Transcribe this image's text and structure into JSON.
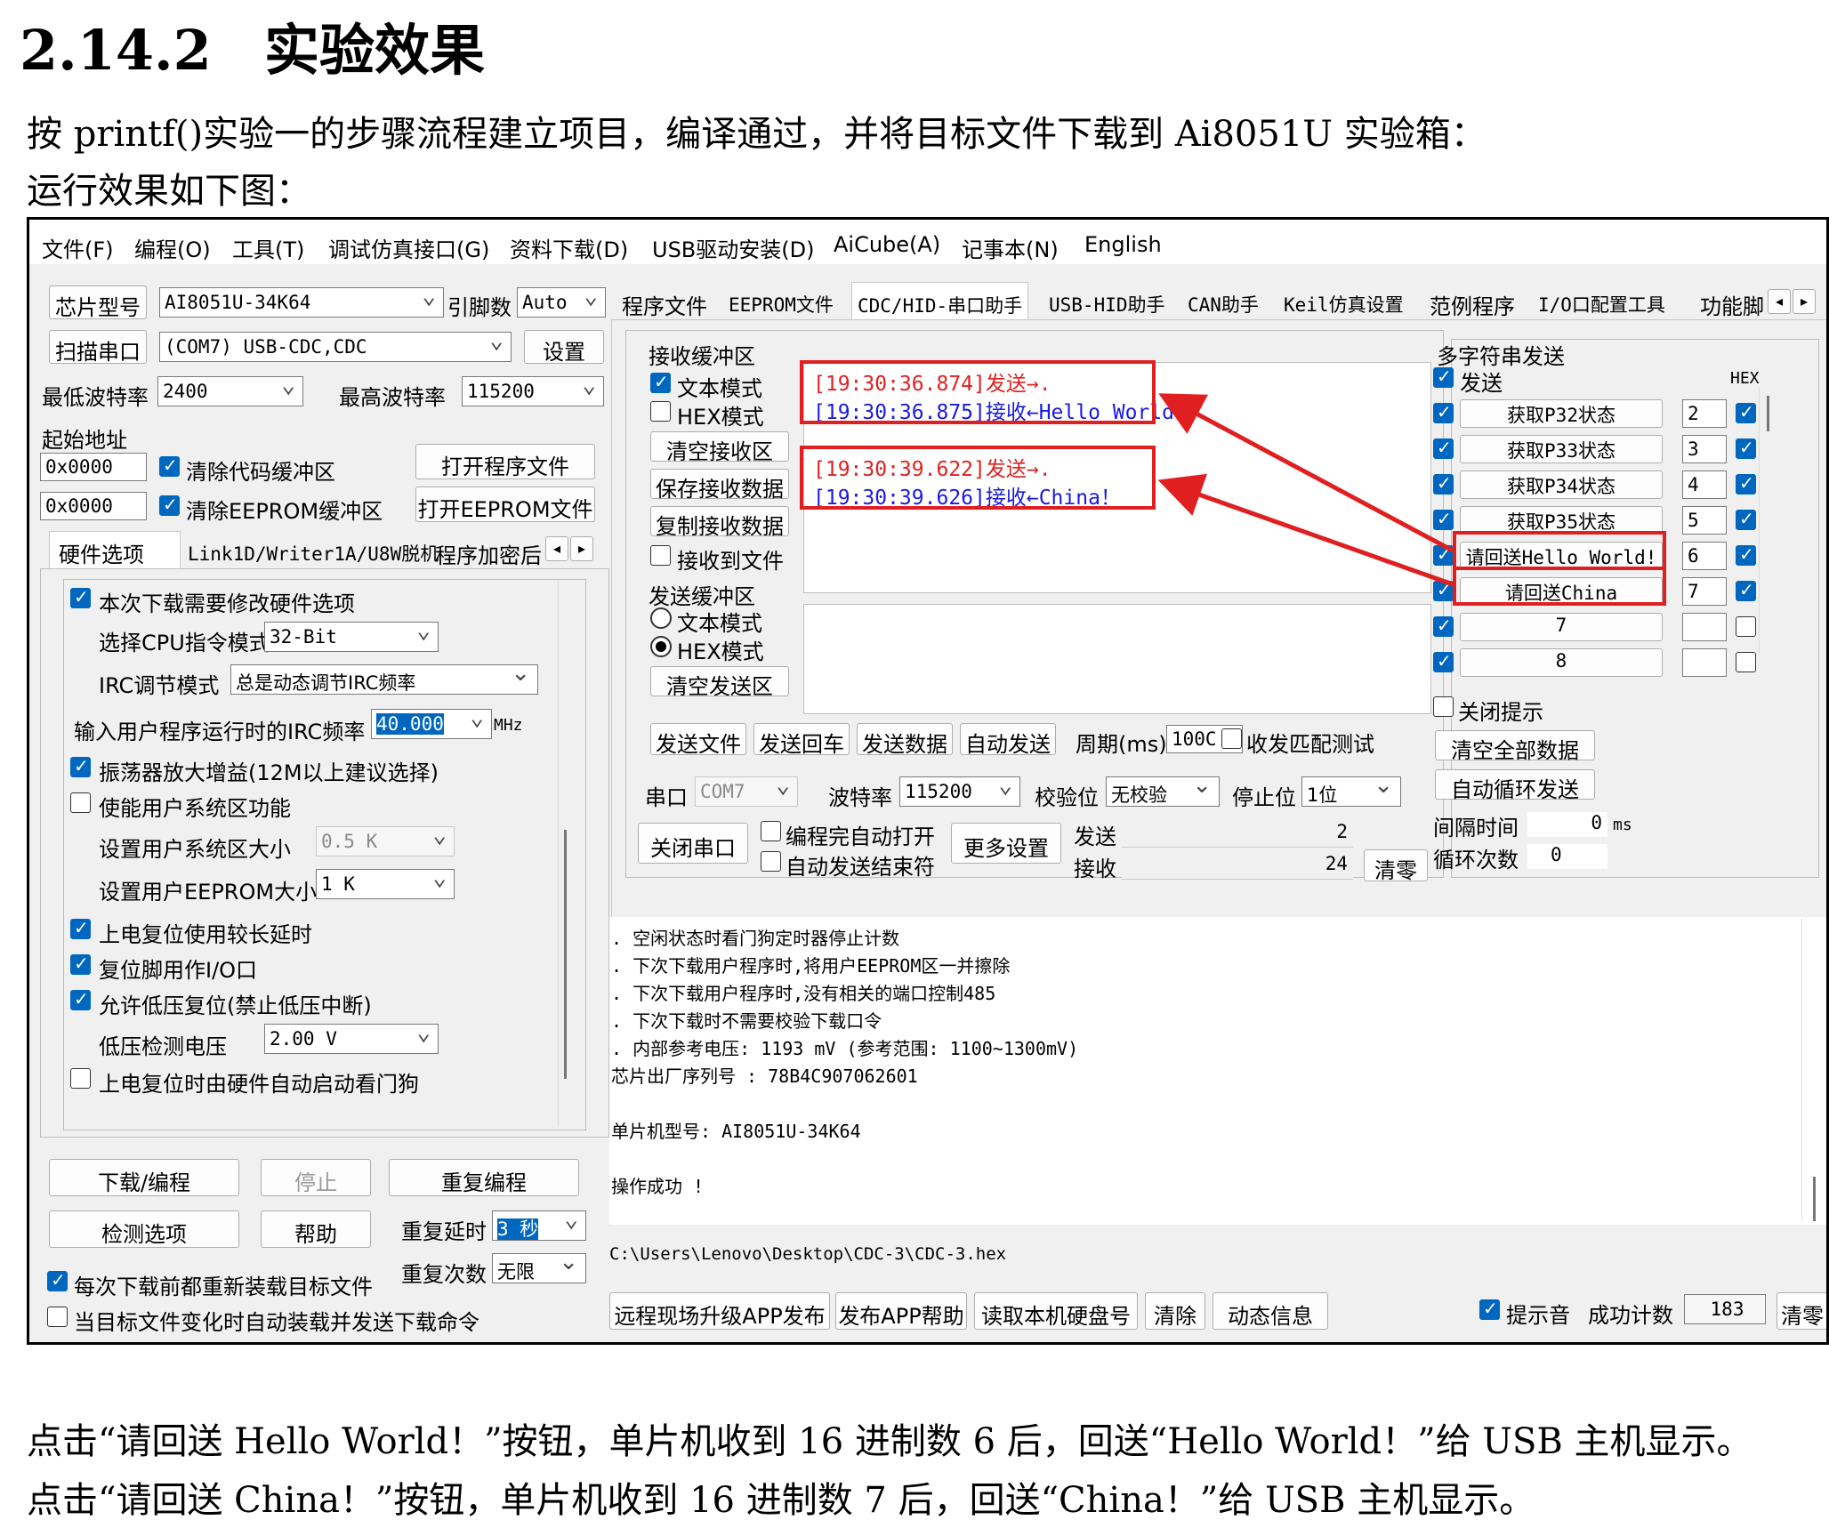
{
  "doc": {
    "section_number": "2.14.2",
    "section_title": "实验效果",
    "intro_line1": "按 printf()实验一的步骤流程建立项目，编译通过，并将目标文件下载到 Ai8051U 实验箱：",
    "intro_line2": "运行效果如下图：",
    "outro_line1": "点击“请回送 Hello World！”按钮，单片机收到 16 进制数 6 后，回送“Hello World！”给 USB 主机显示。",
    "outro_line2": "点击“请回送 China！”按钮，单片机收到 16 进制数 7 后，回送“China！”给 USB 主机显示。"
  },
  "menu": [
    "文件(F)",
    "编程(O)",
    "工具(T)",
    "调试仿真接口(G)",
    "资料下载(D)",
    "USB驱动安装(D)",
    "AiCube(A)",
    "记事本(N)",
    "English"
  ],
  "left": {
    "chip_label": "芯片型号",
    "chip_value": "AI8051U-34K64",
    "pins_label": "引脚数",
    "pins_value": "Auto",
    "scan_label": "扫描串口",
    "port_value": "(COM7) USB-CDC,CDC",
    "settings_label": "设置",
    "min_baud_label": "最低波特率",
    "min_baud_value": "2400",
    "max_baud_label": "最高波特率",
    "max_baud_value": "115200",
    "start_addr_label": "起始地址",
    "addr1": "0x0000",
    "clear_code_label": "清除代码缓冲区",
    "open_prog_label": "打开程序文件",
    "addr2": "0x0000",
    "clear_eeprom_label": "清除EEPROM缓冲区",
    "open_eeprom_label": "打开EEPROM文件",
    "subtabs": [
      "硬件选项",
      "Link1D/Writer1A/U8W脱机",
      "程序加密后"
    ],
    "opt_modify": "本次下载需要修改硬件选项",
    "cpu_mode_label": "选择CPU指令模式",
    "cpu_mode_value": "32-Bit",
    "irc_mode_label": "IRC调节模式",
    "irc_mode_value": "总是动态调节IRC频率",
    "irc_freq_label": "输入用户程序运行时的IRC频率",
    "irc_freq_value": "40.000",
    "irc_freq_unit": "MHz",
    "opt_osc": "振荡器放大增益(12M以上建议选择)",
    "opt_sysarea": "使能用户系统区功能",
    "sysarea_size_label": "设置用户系统区大小",
    "sysarea_size_value": "0.5 K",
    "eeprom_size_label": "设置用户EEPROM大小",
    "eeprom_size_value": "1   K",
    "opt_delay": "上电复位使用较长延时",
    "opt_resetio": "复位脚用作I/O口",
    "opt_lvr": "允许低压复位(禁止低压中断)",
    "lvd_label": "低压检测电压",
    "lvd_value": "2.00 V",
    "opt_wdt": "上电复位时由硬件自动启动看门狗",
    "btn_download": "下载/编程",
    "btn_stop": "停止",
    "btn_repeat": "重复编程",
    "btn_check": "检测选项",
    "btn_help": "帮助",
    "repeat_delay_label": "重复延时",
    "repeat_delay_value": "3 秒",
    "repeat_count_label": "重复次数",
    "repeat_count_value": "无限",
    "reload_label": "每次下载前都重新装载目标文件",
    "autoload_label": "当目标文件变化时自动装载并发送下载命令"
  },
  "tabs": [
    "程序文件",
    "EEPROM文件",
    "CDC/HID-串口助手",
    "USB-HID助手",
    "CAN助手",
    "Keil仿真设置",
    "范例程序",
    "I/O口配置工具",
    "功能脚"
  ],
  "serial": {
    "recv_title": "接收缓冲区",
    "text_mode": "文本模式",
    "hex_mode": "HEX模式",
    "clear_recv": "清空接收区",
    "save_recv": "保存接收数据",
    "copy_recv": "复制接收数据",
    "recv_to_file": "接收到文件",
    "log": [
      {
        "text": "[19:30:36.874]发送→.",
        "color": "#e02020"
      },
      {
        "text": "[19:30:36.875]接收←Hello World！",
        "color": "#1a1ae0"
      },
      {
        "text": "[19:30:39.622]发送→.",
        "color": "#e02020"
      },
      {
        "text": "[19:30:39.626]接收←China！",
        "color": "#1a1ae0"
      }
    ],
    "send_title": "发送缓冲区",
    "send_text_mode": "文本模式",
    "send_hex_mode": "HEX模式",
    "clear_send": "清空发送区",
    "send_file": "发送文件",
    "send_enter": "发送回车",
    "send_data": "发送数据",
    "auto_send": "自动发送",
    "period_label": "周期(ms)",
    "period_value": "100C",
    "match_test": "收发匹配测试",
    "port_label": "串口",
    "port_value": "COM7",
    "baud_label": "波特率",
    "baud_value": "115200",
    "parity_label": "校验位",
    "parity_value": "无校验",
    "stop_label": "停止位",
    "stop_value": "1位",
    "close_port": "关闭串口",
    "auto_open": "编程完自动打开",
    "auto_send_end": "自动发送结束符",
    "more_settings": "更多设置",
    "tx_label": "发送",
    "tx_count": "2",
    "rx_label": "接收",
    "rx_count": "24",
    "clear_count": "清零"
  },
  "multi": {
    "title": "多字符串发送",
    "send_label": "发送",
    "hex_label": "HEX",
    "rows": [
      {
        "label": "获取P32状态",
        "value": "2",
        "hex": true,
        "checked": true
      },
      {
        "label": "获取P33状态",
        "value": "3",
        "hex": true,
        "checked": true
      },
      {
        "label": "获取P34状态",
        "value": "4",
        "hex": true,
        "checked": true
      },
      {
        "label": "获取P35状态",
        "value": "5",
        "hex": true,
        "checked": true
      },
      {
        "label": "请回送Hello World!",
        "value": "6",
        "hex": true,
        "checked": true
      },
      {
        "label": "请回送China",
        "value": "7",
        "hex": true,
        "checked": true
      },
      {
        "label": "7",
        "value": "",
        "hex": false,
        "checked": true
      },
      {
        "label": "8",
        "value": "",
        "hex": false,
        "checked": true
      }
    ],
    "close_tip": "关闭提示",
    "clear_all": "清空全部数据",
    "auto_loop": "自动循环发送",
    "interval_label": "间隔时间",
    "interval_value": "0",
    "interval_unit": "ms",
    "loop_label": "循环次数",
    "loop_value": "0"
  },
  "output": {
    "lines": [
      ". 空闲状态时看门狗定时器停止计数",
      ". 下次下载用户程序时,将用户EEPROM区一并擦除",
      ". 下次下载用户程序时,没有相关的端口控制485",
      ". 下次下载时不需要校验下载口令",
      ". 内部参考电压: 1193 mV (参考范围: 1100~1300mV)",
      "芯片出厂序列号 : 78B4C907062601",
      "",
      "  单片机型号: AI8051U-34K64",
      "",
      "操作成功 !"
    ],
    "path": "C:\\Users\\Lenovo\\Desktop\\CDC-3\\CDC-3.hex"
  },
  "bottom": {
    "remote_upgrade": "远程现场升级APP发布",
    "publish_help": "发布APP帮助",
    "read_disk": "读取本机硬盘号",
    "clear": "清除",
    "dynamic_info": "动态信息",
    "tip_sound": "提示音",
    "success_label": "成功计数",
    "success_value": "183",
    "clear_zero": "清零"
  },
  "colors": {
    "accent": "#0067c0",
    "highlight": "#e02020",
    "recv_text": "#1a1ae0"
  }
}
